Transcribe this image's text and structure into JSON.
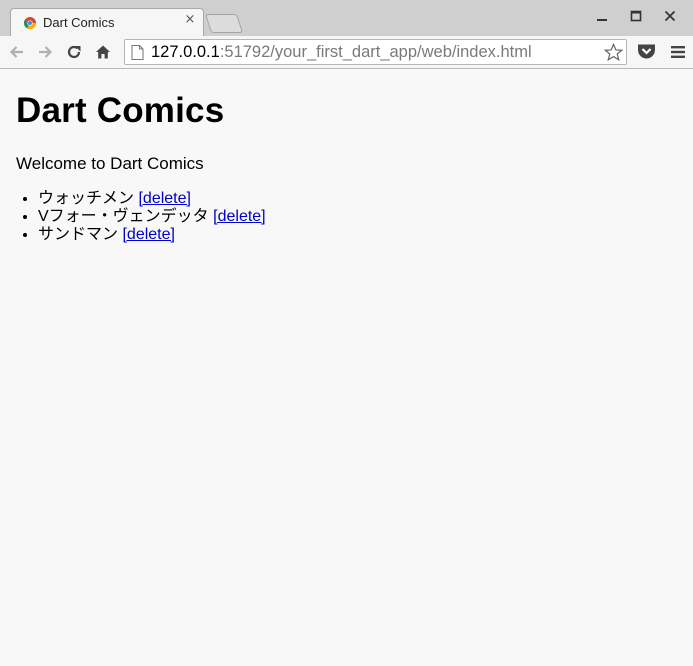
{
  "browser": {
    "tab": {
      "title": "Dart Comics",
      "close_glyph": "×"
    },
    "address_bar": {
      "host": "127.0.0.1",
      "rest": ":51792/your_first_dart_app/web/index.html"
    },
    "icons": {
      "favicon": "chrome-favicon-icon",
      "back": "back-arrow-icon",
      "forward": "forward-arrow-icon",
      "reload": "reload-icon",
      "home": "home-icon",
      "page": "page-icon",
      "bookmark": "star-icon",
      "pocket": "pocket-icon",
      "menu": "hamburger-menu-icon",
      "minimize": "minimize-icon",
      "maximize": "maximize-icon",
      "close": "close-icon"
    }
  },
  "page": {
    "heading": "Dart Comics",
    "welcome": "Welcome to Dart Comics",
    "comics": [
      {
        "title": "ウォッチメン",
        "delete_label": "[delete]"
      },
      {
        "title": "Vフォー・ヴェンデッタ",
        "delete_label": "[delete]"
      },
      {
        "title": "サンドマン",
        "delete_label": "[delete]"
      }
    ]
  },
  "colors": {
    "link": "#0000cc",
    "page_background": "#f8f8f8",
    "chrome_background": "#cfcfcf"
  }
}
